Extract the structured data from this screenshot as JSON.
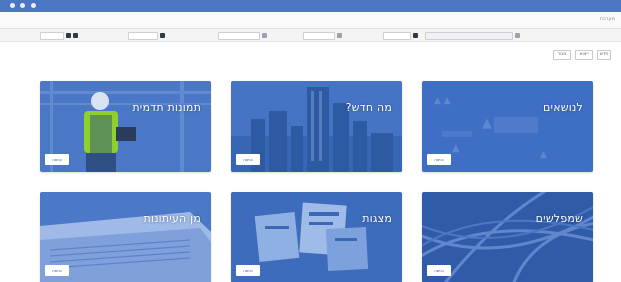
{
  "window": {
    "title_dots": [
      "dot-1",
      "dot-2",
      "dot-3"
    ]
  },
  "header": {
    "app_title": "מערכת"
  },
  "filters": [
    {
      "name": "filter-1",
      "label": ""
    },
    {
      "name": "filter-2",
      "label": ""
    },
    {
      "name": "filter-3",
      "label": ""
    },
    {
      "name": "filter-4",
      "label": ""
    },
    {
      "name": "filter-5",
      "label": ""
    },
    {
      "name": "filter-6",
      "label": ""
    }
  ],
  "actions": {
    "btn1": "חדש",
    "btn2": "ייצוא",
    "btn3": "סגור"
  },
  "tiles": [
    {
      "title": "לנושאים",
      "button": "כניסה"
    },
    {
      "title": "מה חדש?",
      "button": "כניסה"
    },
    {
      "title": "תמונות תדמית",
      "button": "כניסה"
    },
    {
      "title": "שמפלשים",
      "button": "כניסה"
    },
    {
      "title": "מצגות",
      "button": "כניסה"
    },
    {
      "title": "מן העיתונות",
      "button": "כניסה"
    }
  ],
  "colors": {
    "titlebar": "#4a76c3",
    "tile_base": "#3f6fc4"
  }
}
